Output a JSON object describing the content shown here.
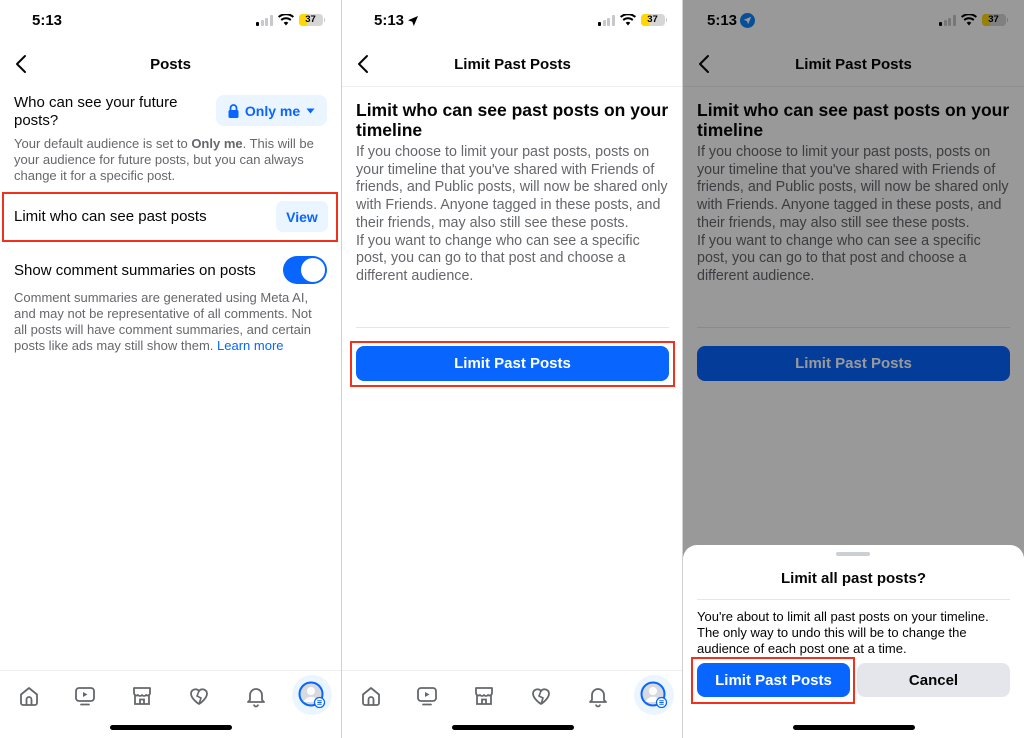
{
  "status_bar": {
    "time": "5:13",
    "battery": "37",
    "battery_level_percent": 37
  },
  "screen1": {
    "nav_title": "Posts",
    "future_posts_label": "Who can see your future posts?",
    "audience_button": "Only me",
    "audience_help_prefix": "Your default audience is set to ",
    "audience_help_bold": "Only me",
    "audience_help_suffix": ". This will be your audience for future posts, but you can always change it for a specific post.",
    "limit_past_label": "Limit who can see past posts",
    "view_button": "View",
    "comment_summaries_label": "Show comment summaries on posts",
    "comment_summaries_on": true,
    "comment_help": "Comment summaries are generated using Meta AI, and may not be representative of all comments. Not all posts will have comment summaries, and certain posts like ads may still show them. ",
    "learn_more": "Learn more"
  },
  "screen2": {
    "nav_title": "Limit Past Posts",
    "heading": "Limit who can see past posts on your timeline",
    "paragraph1": "If you choose to limit your past posts, posts on your timeline that you've shared with Friends of friends, and Public posts, will now be shared only with Friends. Anyone tagged in these posts, and their friends, may also still see these posts.",
    "paragraph2": "If you want to change who can see a specific post, you can go to that post and choose a different audience.",
    "button": "Limit Past Posts"
  },
  "screen3": {
    "nav_title": "Limit Past Posts",
    "heading": "Limit who can see past posts on your timeline",
    "paragraph1": "If you choose to limit your past posts, posts on your timeline that you've shared with Friends of friends, and Public posts, will now be shared only with Friends. Anyone tagged in these posts, and their friends, may also still see these posts.",
    "paragraph2": "If you want to change who can see a specific post, you can go to that post and choose a different audience.",
    "button": "Limit Past Posts",
    "sheet": {
      "title": "Limit all past posts?",
      "body": "You're about to limit all past posts on your timeline. The only way to undo this will be to change the audience of each post one at a time.",
      "confirm": "Limit Past Posts",
      "cancel": "Cancel"
    }
  },
  "tab_bar": {
    "icons": [
      "home-icon",
      "video-icon",
      "marketplace-icon",
      "dating-heart-icon",
      "notifications-bell-icon",
      "profile-menu-icon"
    ]
  },
  "colors": {
    "accent": "#0866ff",
    "accent_light": "#ebf5ff",
    "highlight_box": "#f0311b",
    "secondary_text": "#65676b"
  }
}
